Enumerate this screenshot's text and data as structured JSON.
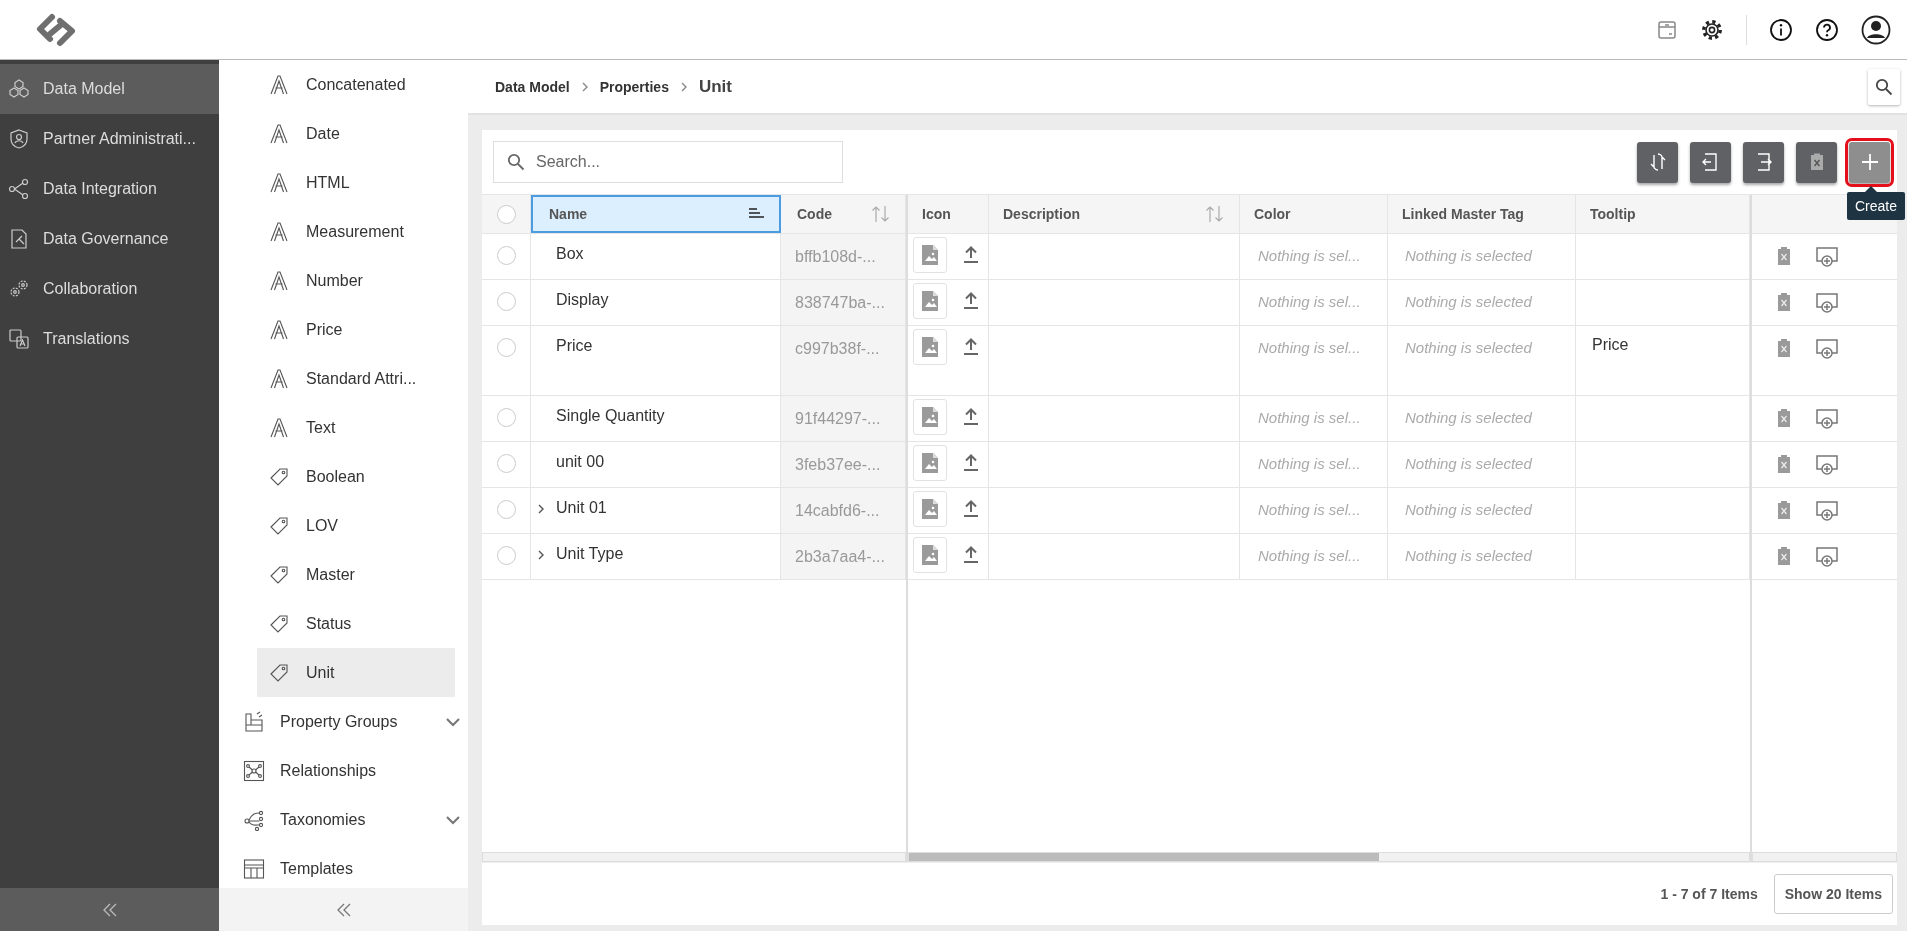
{
  "nav": {
    "items": [
      {
        "label": "Data Model",
        "kind": "data-model",
        "selected": true
      },
      {
        "label": "Partner Administrati...",
        "kind": "partner",
        "selected": false
      },
      {
        "label": "Data Integration",
        "kind": "integration",
        "selected": false
      },
      {
        "label": "Data Governance",
        "kind": "governance",
        "selected": false
      },
      {
        "label": "Collaboration",
        "kind": "collaboration",
        "selected": false
      },
      {
        "label": "Translations",
        "kind": "translations",
        "selected": false
      }
    ]
  },
  "subnav": {
    "items": [
      {
        "label": "Concatenated",
        "kind": "attribute",
        "selected": false
      },
      {
        "label": "Date",
        "kind": "attribute",
        "selected": false
      },
      {
        "label": "HTML",
        "kind": "attribute",
        "selected": false
      },
      {
        "label": "Measurement",
        "kind": "attribute",
        "selected": false
      },
      {
        "label": "Number",
        "kind": "attribute",
        "selected": false
      },
      {
        "label": "Price",
        "kind": "attribute",
        "selected": false
      },
      {
        "label": "Standard Attri...",
        "kind": "attribute",
        "selected": false
      },
      {
        "label": "Text",
        "kind": "attribute",
        "selected": false
      },
      {
        "label": "Boolean",
        "kind": "tag",
        "selected": false
      },
      {
        "label": "LOV",
        "kind": "tag",
        "selected": false
      },
      {
        "label": "Master",
        "kind": "tag",
        "selected": false
      },
      {
        "label": "Status",
        "kind": "tag",
        "selected": false
      },
      {
        "label": "Unit",
        "kind": "tag",
        "selected": true
      },
      {
        "label": "Property Groups",
        "kind": "property-groups",
        "selected": false,
        "expanded": false
      },
      {
        "label": "Relationships",
        "kind": "relationships",
        "selected": false
      },
      {
        "label": "Taxonomies",
        "kind": "taxonomies",
        "selected": false,
        "expanded": false
      },
      {
        "label": "Templates",
        "kind": "templates",
        "selected": false
      }
    ]
  },
  "breadcrumb": [
    "Data Model",
    "Properties",
    "Unit"
  ],
  "toolbar": {
    "search": {
      "placeholder": "Search..."
    },
    "buttons": [
      {
        "kind": "sync",
        "highlighted": false
      },
      {
        "kind": "import",
        "highlighted": false
      },
      {
        "kind": "export",
        "highlighted": false
      },
      {
        "kind": "delete",
        "highlighted": false
      },
      {
        "kind": "create",
        "highlighted": true
      }
    ],
    "tooltip": "Create"
  },
  "table": {
    "columns": [
      {
        "label": "Name",
        "sorted": true,
        "selected": true
      },
      {
        "label": "Code",
        "sorted": false,
        "selected": false
      },
      {
        "label": "Icon",
        "selected": false
      },
      {
        "label": "Description",
        "sorted": false,
        "selected": false
      },
      {
        "label": "Color",
        "selected": false
      },
      {
        "label": "Linked Master Tag",
        "selected": false
      },
      {
        "label": "Tooltip",
        "selected": false
      }
    ],
    "all_selected": false,
    "rows": [
      {
        "selected": false,
        "name": "Box",
        "code": "bffb108d-...",
        "color_value": "Nothing is sel...",
        "linked_master_tag": "Nothing is selected"
      },
      {
        "selected": false,
        "name": "Display",
        "code": "838747ba-...",
        "color_value": "Nothing is sel...",
        "linked_master_tag": "Nothing is selected"
      },
      {
        "selected": false,
        "name": "Price",
        "code": "c997b38f-...",
        "color_value": "Nothing is sel...",
        "linked_master_tag": "Nothing is selected",
        "tooltip": "Price"
      },
      {
        "selected": false,
        "name": "Single Quantity",
        "code": "91f44297-...",
        "color_value": "Nothing is sel...",
        "linked_master_tag": "Nothing is selected"
      },
      {
        "selected": false,
        "name": "unit 00",
        "code": "3feb37ee-...",
        "color_value": "Nothing is sel...",
        "linked_master_tag": "Nothing is selected"
      },
      {
        "selected": false,
        "expanded": false,
        "name": "Unit 01",
        "code": "14cabfd6-...",
        "color_value": "Nothing is sel...",
        "linked_master_tag": "Nothing is selected"
      },
      {
        "selected": false,
        "expanded": false,
        "name": "Unit Type",
        "code": "2b3a7aa4-...",
        "color_value": "Nothing is sel...",
        "linked_master_tag": "Nothing is selected"
      }
    ]
  },
  "footer": {
    "range": "1 - 7 of 7 Items",
    "page_size": "Show 20 Items"
  }
}
